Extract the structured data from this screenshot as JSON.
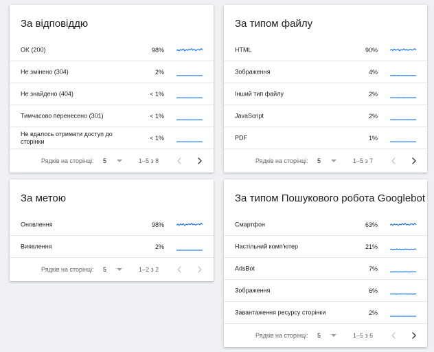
{
  "theme": {
    "line_color": "#1a73e8",
    "disabled_color": "#c5c8cc",
    "enabled_color": "#3c4043"
  },
  "cards": [
    {
      "id": "response",
      "title": "За відповіддю",
      "rows": [
        {
          "label": "OK (200)",
          "value": "98%",
          "spark": [
            0.45,
            0.55,
            0.42,
            0.6,
            0.5,
            0.65,
            0.4,
            0.58,
            0.48,
            0.62,
            0.55,
            0.7,
            0.5,
            0.6,
            0.45,
            0.55,
            0.6,
            0.5,
            0.72,
            0.52
          ]
        },
        {
          "label": "Не змінено (304)",
          "value": "2%",
          "spark": [
            0.05,
            0.05,
            0.06,
            0.05,
            0.05,
            0.05,
            0.06,
            0.05,
            0.05,
            0.05,
            0.05,
            0.06,
            0.05,
            0.05,
            0.05,
            0.05,
            0.05,
            0.06,
            0.05,
            0.05
          ]
        },
        {
          "label": "Не знайдено (404)",
          "value": "< 1%",
          "spark": [
            0.03,
            0.03,
            0.03,
            0.03,
            0.03,
            0.03,
            0.03,
            0.03,
            0.03,
            0.03,
            0.03,
            0.03,
            0.03,
            0.03,
            0.03,
            0.03,
            0.03,
            0.03,
            0.03,
            0.03
          ]
        },
        {
          "label": "Тимчасово перенесено (301)",
          "value": "< 1%",
          "spark": [
            0.03,
            0.03,
            0.03,
            0.03,
            0.03,
            0.03,
            0.03,
            0.03,
            0.03,
            0.03,
            0.03,
            0.03,
            0.03,
            0.03,
            0.03,
            0.03,
            0.03,
            0.03,
            0.03,
            0.03
          ]
        },
        {
          "label": "Не вдалось отримати доступ до сторінки",
          "value": "< 1%",
          "spark": [
            0.03,
            0.03,
            0.03,
            0.03,
            0.03,
            0.03,
            0.03,
            0.03,
            0.03,
            0.03,
            0.03,
            0.03,
            0.03,
            0.03,
            0.03,
            0.03,
            0.03,
            0.03,
            0.03,
            0.03
          ]
        }
      ],
      "footer": {
        "rows_per_page_label": "Рядків на сторінці:",
        "rows_per_page": "5",
        "range": "1–5 з 8",
        "prev_enabled": false,
        "next_enabled": true
      }
    },
    {
      "id": "filetype",
      "title": "За типом файлу",
      "rows": [
        {
          "label": "HTML",
          "value": "90%",
          "spark": [
            0.5,
            0.6,
            0.45,
            0.65,
            0.5,
            0.55,
            0.62,
            0.42,
            0.58,
            0.5,
            0.68,
            0.5,
            0.6,
            0.48,
            0.55,
            0.62,
            0.5,
            0.58,
            0.7,
            0.5
          ]
        },
        {
          "label": "Зображення",
          "value": "4%",
          "spark": [
            0.05,
            0.06,
            0.05,
            0.08,
            0.05,
            0.05,
            0.07,
            0.05,
            0.05,
            0.06,
            0.05,
            0.05,
            0.08,
            0.05,
            0.05,
            0.06,
            0.05,
            0.07,
            0.05,
            0.05
          ]
        },
        {
          "label": "Інший тип файлу",
          "value": "2%",
          "spark": [
            0.04,
            0.04,
            0.05,
            0.04,
            0.04,
            0.04,
            0.05,
            0.04,
            0.04,
            0.04,
            0.05,
            0.04,
            0.04,
            0.04,
            0.05,
            0.04,
            0.04,
            0.04,
            0.05,
            0.04
          ]
        },
        {
          "label": "JavaScript",
          "value": "2%",
          "spark": [
            0.04,
            0.04,
            0.04,
            0.05,
            0.04,
            0.04,
            0.04,
            0.04,
            0.05,
            0.04,
            0.04,
            0.04,
            0.04,
            0.05,
            0.04,
            0.04,
            0.04,
            0.04,
            0.05,
            0.04
          ]
        },
        {
          "label": "PDF",
          "value": "1%",
          "spark": [
            0.03,
            0.03,
            0.03,
            0.03,
            0.03,
            0.03,
            0.03,
            0.03,
            0.03,
            0.03,
            0.03,
            0.03,
            0.03,
            0.03,
            0.03,
            0.03,
            0.03,
            0.03,
            0.03,
            0.03
          ]
        }
      ],
      "footer": {
        "rows_per_page_label": "Рядків на сторінці:",
        "rows_per_page": "5",
        "range": "1–5 з 7",
        "prev_enabled": false,
        "next_enabled": true
      }
    },
    {
      "id": "purpose",
      "title": "За метою",
      "rows": [
        {
          "label": "Оновлення",
          "value": "98%",
          "spark": [
            0.45,
            0.58,
            0.42,
            0.62,
            0.5,
            0.65,
            0.4,
            0.58,
            0.5,
            0.62,
            0.52,
            0.7,
            0.5,
            0.6,
            0.45,
            0.58,
            0.62,
            0.5,
            0.72,
            0.52
          ]
        },
        {
          "label": "Виявлення",
          "value": "2%",
          "spark": [
            0.05,
            0.05,
            0.05,
            0.06,
            0.05,
            0.05,
            0.05,
            0.05,
            0.06,
            0.05,
            0.05,
            0.05,
            0.05,
            0.05,
            0.06,
            0.05,
            0.05,
            0.05,
            0.05,
            0.05
          ]
        }
      ],
      "footer": {
        "rows_per_page_label": "Рядків на сторінці:",
        "rows_per_page": "5",
        "range": "1–2 з 2",
        "prev_enabled": false,
        "next_enabled": false
      }
    },
    {
      "id": "googlebot",
      "title": "За типом Пошукового робота Googlebot",
      "rows": [
        {
          "label": "Смартфон",
          "value": "63%",
          "spark": [
            0.45,
            0.6,
            0.42,
            0.62,
            0.5,
            0.58,
            0.42,
            0.6,
            0.5,
            0.65,
            0.52,
            0.7,
            0.48,
            0.58,
            0.45,
            0.6,
            0.62,
            0.5,
            0.7,
            0.5
          ]
        },
        {
          "label": "Настільний комп'ютер",
          "value": "21%",
          "spark": [
            0.15,
            0.2,
            0.12,
            0.18,
            0.15,
            0.22,
            0.14,
            0.2,
            0.15,
            0.18,
            0.14,
            0.22,
            0.16,
            0.2,
            0.14,
            0.18,
            0.2,
            0.15,
            0.22,
            0.16
          ]
        },
        {
          "label": "AdsBot",
          "value": "7%",
          "spark": [
            0.08,
            0.1,
            0.07,
            0.12,
            0.08,
            0.1,
            0.06,
            0.11,
            0.08,
            0.1,
            0.07,
            0.12,
            0.08,
            0.1,
            0.07,
            0.11,
            0.09,
            0.08,
            0.12,
            0.08
          ]
        },
        {
          "label": "Зображення",
          "value": "6%",
          "spark": [
            0.07,
            0.09,
            0.06,
            0.1,
            0.07,
            0.08,
            0.06,
            0.1,
            0.07,
            0.09,
            0.06,
            0.1,
            0.07,
            0.08,
            0.06,
            0.09,
            0.08,
            0.07,
            0.1,
            0.07
          ]
        },
        {
          "label": "Завантаження ресурсу сторінки",
          "value": "2%",
          "spark": [
            0.04,
            0.04,
            0.05,
            0.04,
            0.04,
            0.04,
            0.05,
            0.04,
            0.04,
            0.04,
            0.05,
            0.04,
            0.04,
            0.04,
            0.05,
            0.04,
            0.04,
            0.04,
            0.05,
            0.04
          ]
        }
      ],
      "footer": {
        "rows_per_page_label": "Рядків на сторінці:",
        "rows_per_page": "5",
        "range": "1–5 з 6",
        "prev_enabled": false,
        "next_enabled": true
      }
    }
  ]
}
